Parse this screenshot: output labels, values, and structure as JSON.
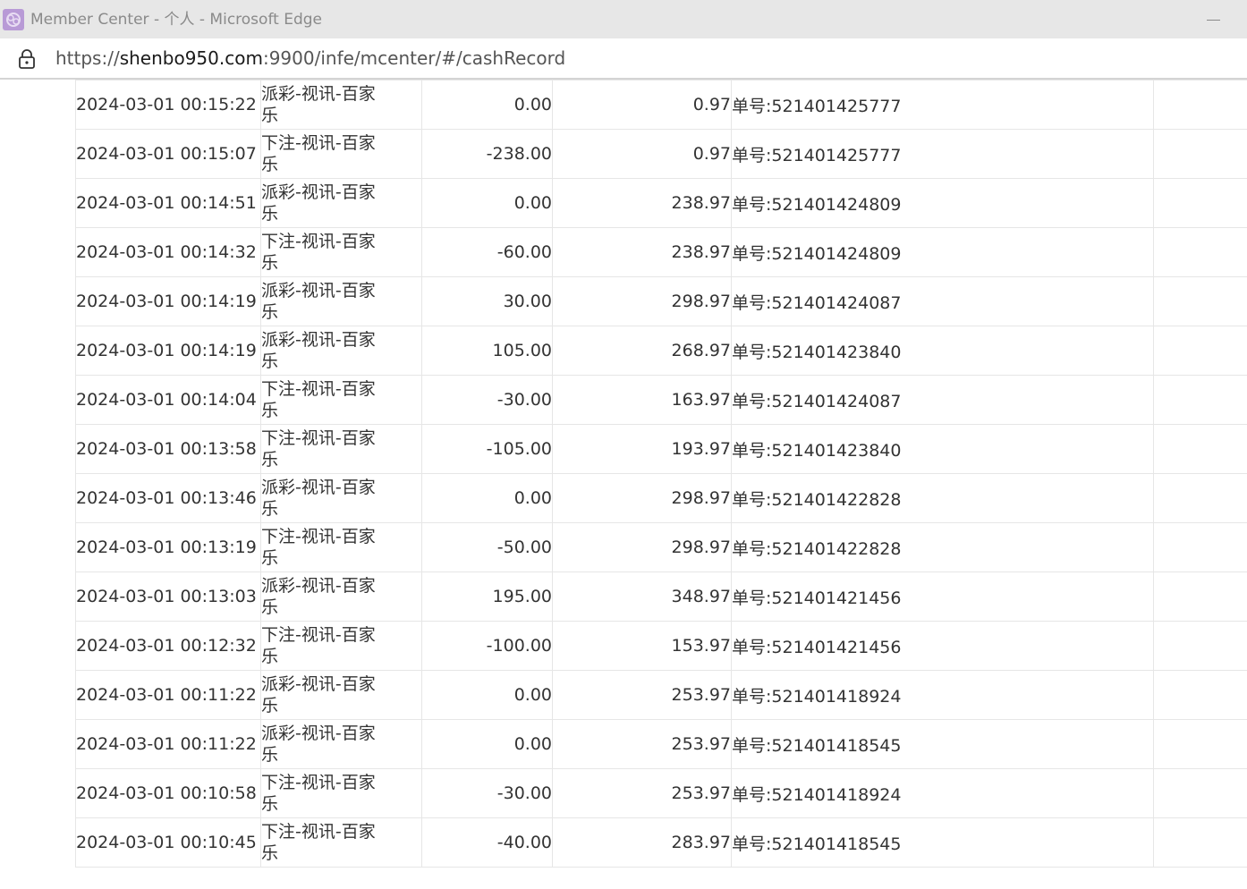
{
  "window": {
    "title": "Member Center - 个人 - Microsoft Edge",
    "app_icon": "edge-profile-icon",
    "controls": {
      "minimize_icon": "minimize-icon"
    }
  },
  "addressbar": {
    "lock_icon": "lock-icon",
    "url_scheme": "https://",
    "url_host": "shenbo950.com",
    "url_path": ":9900/infe/mcenter/#/cashRecord"
  },
  "table": {
    "rows": [
      {
        "time": "2024-03-01 00:15:22",
        "type": "派彩-视讯-百家乐",
        "amount": "0.00",
        "balance": "0.97",
        "note": "单号:521401425777"
      },
      {
        "time": "2024-03-01 00:15:07",
        "type": "下注-视讯-百家乐",
        "amount": "-238.00",
        "balance": "0.97",
        "note": "单号:521401425777"
      },
      {
        "time": "2024-03-01 00:14:51",
        "type": "派彩-视讯-百家乐",
        "amount": "0.00",
        "balance": "238.97",
        "note": "单号:521401424809"
      },
      {
        "time": "2024-03-01 00:14:32",
        "type": "下注-视讯-百家乐",
        "amount": "-60.00",
        "balance": "238.97",
        "note": "单号:521401424809"
      },
      {
        "time": "2024-03-01 00:14:19",
        "type": "派彩-视讯-百家乐",
        "amount": "30.00",
        "balance": "298.97",
        "note": "单号:521401424087"
      },
      {
        "time": "2024-03-01 00:14:19",
        "type": "派彩-视讯-百家乐",
        "amount": "105.00",
        "balance": "268.97",
        "note": "单号:521401423840"
      },
      {
        "time": "2024-03-01 00:14:04",
        "type": "下注-视讯-百家乐",
        "amount": "-30.00",
        "balance": "163.97",
        "note": "单号:521401424087"
      },
      {
        "time": "2024-03-01 00:13:58",
        "type": "下注-视讯-百家乐",
        "amount": "-105.00",
        "balance": "193.97",
        "note": "单号:521401423840"
      },
      {
        "time": "2024-03-01 00:13:46",
        "type": "派彩-视讯-百家乐",
        "amount": "0.00",
        "balance": "298.97",
        "note": "单号:521401422828"
      },
      {
        "time": "2024-03-01 00:13:19",
        "type": "下注-视讯-百家乐",
        "amount": "-50.00",
        "balance": "298.97",
        "note": "单号:521401422828"
      },
      {
        "time": "2024-03-01 00:13:03",
        "type": "派彩-视讯-百家乐",
        "amount": "195.00",
        "balance": "348.97",
        "note": "单号:521401421456"
      },
      {
        "time": "2024-03-01 00:12:32",
        "type": "下注-视讯-百家乐",
        "amount": "-100.00",
        "balance": "153.97",
        "note": "单号:521401421456"
      },
      {
        "time": "2024-03-01 00:11:22",
        "type": "派彩-视讯-百家乐",
        "amount": "0.00",
        "balance": "253.97",
        "note": "单号:521401418924"
      },
      {
        "time": "2024-03-01 00:11:22",
        "type": "派彩-视讯-百家乐",
        "amount": "0.00",
        "balance": "253.97",
        "note": "单号:521401418545"
      },
      {
        "time": "2024-03-01 00:10:58",
        "type": "下注-视讯-百家乐",
        "amount": "-30.00",
        "balance": "253.97",
        "note": "单号:521401418924"
      },
      {
        "time": "2024-03-01 00:10:45",
        "type": "下注-视讯-百家乐",
        "amount": "-40.00",
        "balance": "283.97",
        "note": "单号:521401418545"
      }
    ]
  },
  "colors": {
    "titlebar_bg": "#e7e7e7",
    "title_text": "#8a8a8a",
    "table_border": "#e6e6e6",
    "text": "#333333"
  }
}
